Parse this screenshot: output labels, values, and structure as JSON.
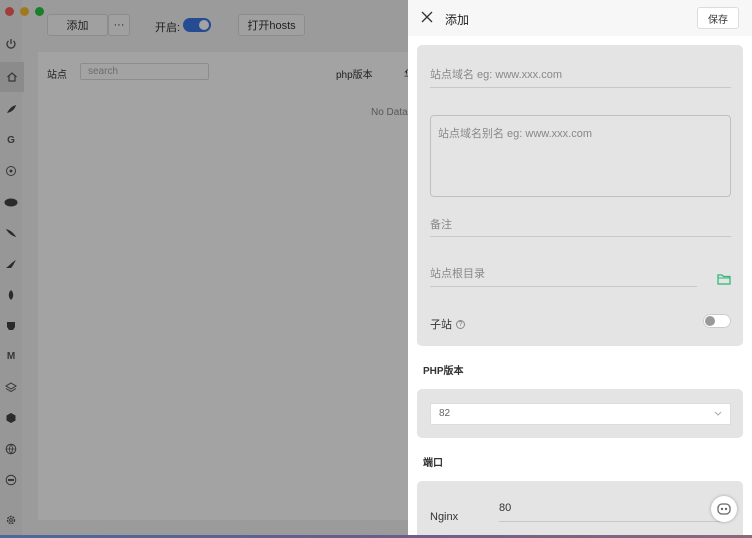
{
  "background": {
    "toolbar": {
      "add_label": "添加",
      "more_label": "···",
      "enable_label": "开启:",
      "hosts_label": "打开hosts"
    },
    "table": {
      "site_col": "站点",
      "search_placeholder": "search",
      "php_col": "php版本",
      "php_col_tail": "华",
      "empty_text": "No Data"
    },
    "sidebar_icons": [
      "power-icon",
      "home-icon",
      "feather-icon",
      "g-icon",
      "elephant-icon",
      "php-icon",
      "feather2-icon",
      "dolphin-icon",
      "leaf-icon",
      "elephant2-icon",
      "m-icon",
      "layers-icon",
      "hexagon-icon",
      "globe-icon",
      "dns-icon",
      "gear-icon"
    ]
  },
  "drawer": {
    "title": "添加",
    "save_label": "保存",
    "fields": {
      "domain_placeholder": "站点域名 eg: www.xxx.com",
      "alias_placeholder": "站点域名别名 eg: www.xxx.com",
      "note_placeholder": "备注",
      "root_placeholder": "站点根目录",
      "sub_site_label": "子站",
      "help_glyph": "?"
    },
    "php_section": {
      "title": "PHP版本",
      "selected": "82"
    },
    "port_section": {
      "title": "端口",
      "nginx_label": "Nginx",
      "nginx_value": "80"
    },
    "colors": {
      "accent": "#3b78e7",
      "folder": "#2bb673"
    }
  }
}
